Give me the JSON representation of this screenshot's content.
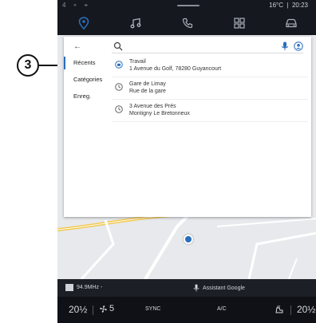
{
  "callout": {
    "number": "3"
  },
  "status": {
    "left_icons": "4 ⚬ ⌖",
    "temperature": "16°C",
    "time": "20:23"
  },
  "topnav": {
    "items": [
      {
        "icon": "navigation-icon",
        "active": true
      },
      {
        "icon": "music-icon"
      },
      {
        "icon": "phone-icon"
      },
      {
        "icon": "apps-grid-icon"
      },
      {
        "icon": "car-icon"
      }
    ]
  },
  "panel": {
    "back_icon": "back-arrow-icon",
    "search": {
      "placeholder": ""
    },
    "sidenav": [
      {
        "label": "Récents",
        "active": true
      },
      {
        "label": "Catégories"
      },
      {
        "label": "Enreg."
      }
    ],
    "results": [
      {
        "icon": "work-pin-icon",
        "line1": "Travail",
        "line2": "1 Avenue du Golf, 78280 Guyancourt"
      },
      {
        "icon": "history-icon",
        "line1": "Gare de Limay",
        "line2": "Rue de la gare"
      },
      {
        "icon": "history-icon",
        "line1": "3 Avenue des Prés",
        "line2": "Montigny Le Bretonneux"
      }
    ]
  },
  "media": {
    "radio": "94.9MHz -",
    "assistant": "Assistant Google"
  },
  "climate": {
    "temp_left": "20½",
    "fan_level": "5",
    "sync": "SYNC",
    "ac": "A/C",
    "temp_right": "20½"
  },
  "colors": {
    "accent": "#2a6ebb",
    "screen_bg": "#15181e",
    "map_bg": "#e7e9ec"
  }
}
